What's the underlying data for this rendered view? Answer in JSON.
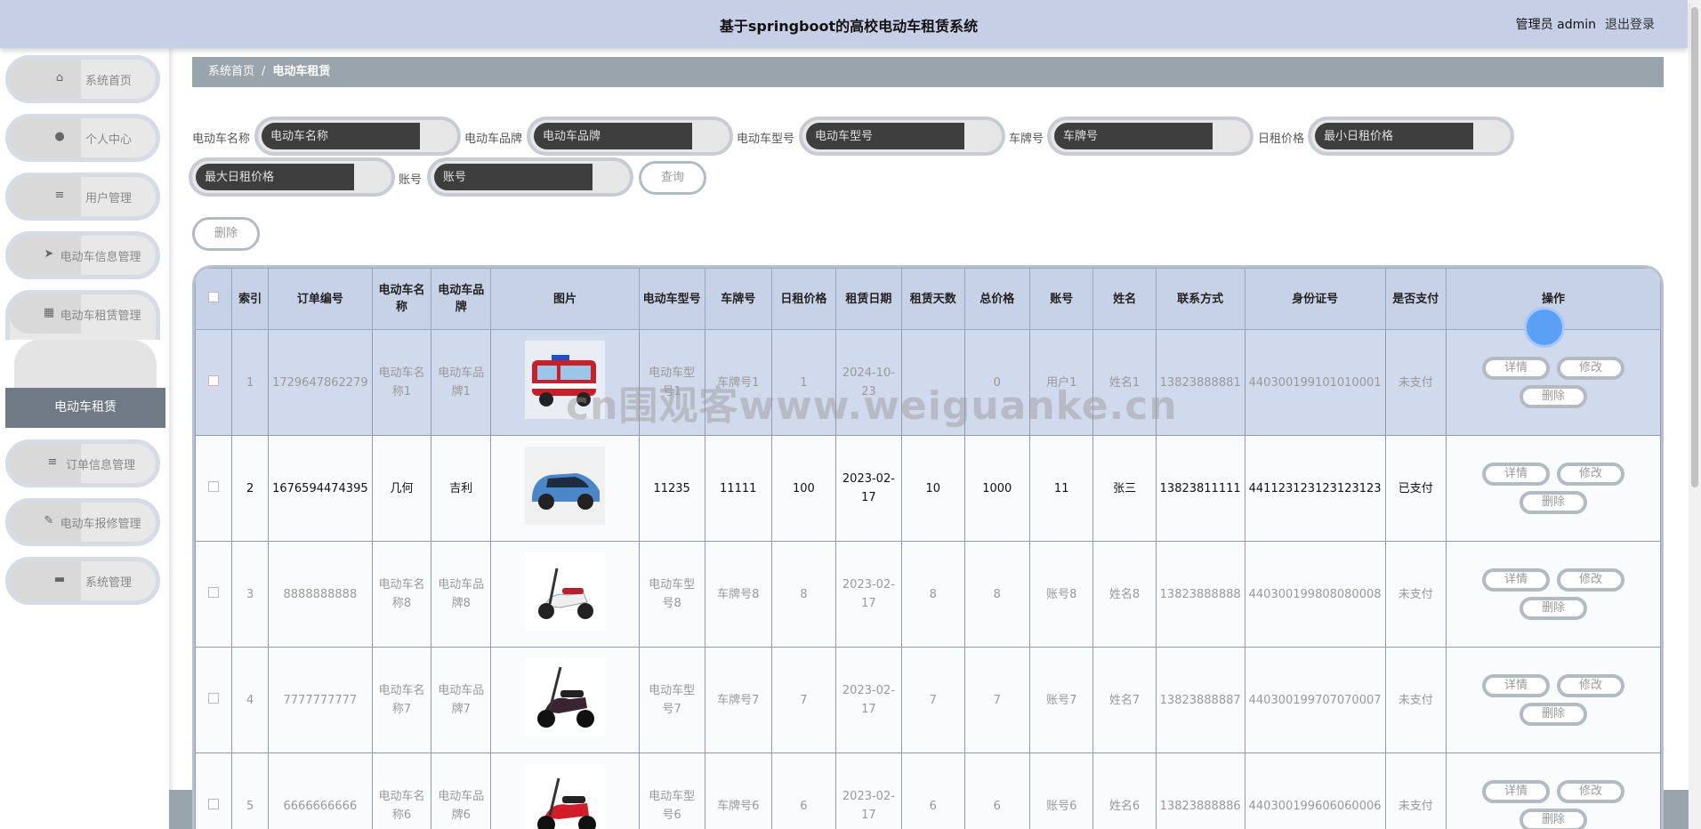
{
  "header": {
    "title": "基于springboot的高校电动车租赁系统",
    "user": "管理员 admin",
    "logout": "退出登录"
  },
  "sidebar": {
    "items": [
      {
        "label": "系统首页",
        "icon": "home-icon",
        "glyph": "⌂"
      },
      {
        "label": "个人中心",
        "icon": "user-icon",
        "glyph": "●"
      },
      {
        "label": "用户管理",
        "icon": "list-icon",
        "glyph": "≡"
      },
      {
        "label": "电动车信息管理",
        "icon": "send-icon",
        "glyph": "➤"
      },
      {
        "label": "电动车租赁管理",
        "icon": "grid-icon",
        "glyph": "▦"
      },
      {
        "label": "订单信息管理",
        "icon": "list-icon",
        "glyph": "≡"
      },
      {
        "label": "电动车报修管理",
        "icon": "thumb-icon",
        "glyph": "✎"
      },
      {
        "label": "系统管理",
        "icon": "briefcase-icon",
        "glyph": "▬"
      }
    ],
    "submenu_active": "电动车租赁"
  },
  "breadcrumb": {
    "home": "系统首页",
    "sep": "/",
    "current": "电动车租赁"
  },
  "search": {
    "name_label": "电动车名称",
    "name_placeholder": "电动车名称",
    "brand_label": "电动车品牌",
    "brand_placeholder": "电动车品牌",
    "model_label": "电动车型号",
    "model_placeholder": "电动车型号",
    "plate_label": "车牌号",
    "plate_placeholder": "车牌号",
    "price_label": "日租价格",
    "min_placeholder": "最小日租价格",
    "max_placeholder": "最大日租价格",
    "account_label": "账号",
    "account_placeholder": "账号",
    "query": "查询",
    "delete": "删除"
  },
  "table": {
    "headers": {
      "index": "索引",
      "order_no": "订单编号",
      "name": "电动车名称",
      "brand": "电动车品牌",
      "image": "图片",
      "model": "电动车型号",
      "plate": "车牌号",
      "price": "日租价格",
      "date": "租赁日期",
      "days": "租赁天数",
      "total": "总价格",
      "account": "账号",
      "person": "姓名",
      "phone": "联系方式",
      "id_card": "身份证号",
      "paid": "是否支付",
      "ops": "操作"
    },
    "actions": {
      "detail": "详情",
      "edit": "修改",
      "delete": "删除"
    },
    "rows": [
      {
        "index": "1",
        "order_no": "1729647862279",
        "name": "电动车名称1",
        "brand": "电动车品牌1",
        "image": "red-fire-cart",
        "model": "电动车型号1",
        "plate": "车牌号1",
        "price": "1",
        "date": "2024-10-23",
        "days": "",
        "total": "0",
        "account": "用户1",
        "person": "姓名1",
        "phone": "13823888881",
        "id_card": "440300199101010001",
        "paid": "未支付"
      },
      {
        "index": "2",
        "order_no": "1676594474395",
        "name": "几何",
        "brand": "吉利",
        "image": "blue-car",
        "model": "11235",
        "plate": "11111",
        "price": "100",
        "date": "2023-02-17",
        "days": "10",
        "total": "1000",
        "account": "11",
        "person": "张三",
        "phone": "13823811111",
        "id_card": "441123123123123123",
        "paid": "已支付"
      },
      {
        "index": "3",
        "order_no": "8888888888",
        "name": "电动车名称8",
        "brand": "电动车品牌8",
        "image": "white-scooter",
        "model": "电动车型号8",
        "plate": "车牌号8",
        "price": "8",
        "date": "2023-02-17",
        "days": "8",
        "total": "8",
        "account": "账号8",
        "person": "姓名8",
        "phone": "13823888888",
        "id_card": "440300199808080008",
        "paid": "未支付"
      },
      {
        "index": "4",
        "order_no": "7777777777",
        "name": "电动车名称7",
        "brand": "电动车品牌7",
        "image": "dark-scooter",
        "model": "电动车型号7",
        "plate": "车牌号7",
        "price": "7",
        "date": "2023-02-17",
        "days": "7",
        "total": "7",
        "account": "账号7",
        "person": "姓名7",
        "phone": "13823888887",
        "id_card": "440300199707070007",
        "paid": "未支付"
      },
      {
        "index": "5",
        "order_no": "6666666666",
        "name": "电动车名称6",
        "brand": "电动车品牌6",
        "image": "red-scooter",
        "model": "电动车型号6",
        "plate": "车牌号6",
        "price": "6",
        "date": "2023-02-17",
        "days": "6",
        "total": "6",
        "account": "账号6",
        "person": "姓名6",
        "phone": "13823888886",
        "id_card": "440300199606060006",
        "paid": "未支付"
      }
    ]
  },
  "watermark": "cn围观客www.weiguanke.cn"
}
